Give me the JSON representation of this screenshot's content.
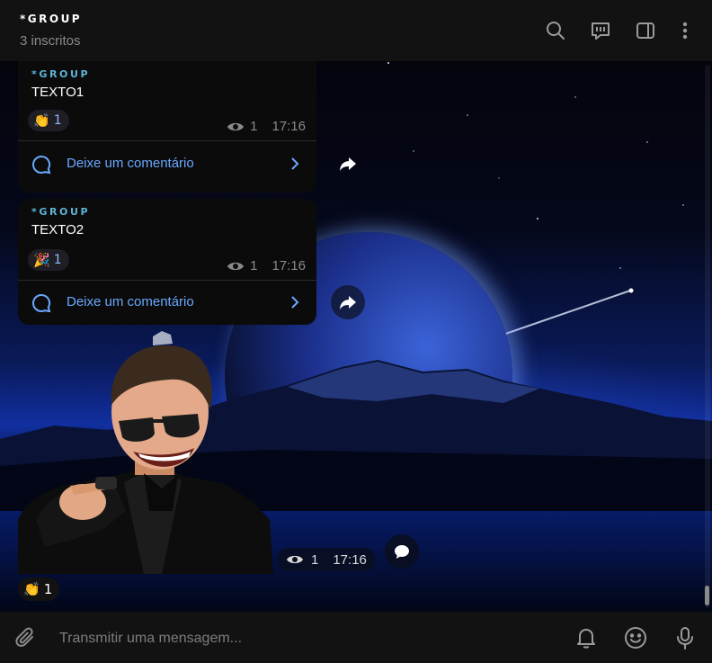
{
  "header": {
    "title": "*GROUP",
    "subtitle": "3 inscritos",
    "icons": [
      "search-icon",
      "live-chat-icon",
      "sidebar-toggle-icon",
      "more-vertical-icon"
    ]
  },
  "messages": [
    {
      "sender": "*GROUP",
      "text": "TEXTO1",
      "reaction": {
        "emoji": "👏",
        "count": "1"
      },
      "views": "1",
      "time": "17:16",
      "comment_label": "Deixe um comentário"
    },
    {
      "sender": "*GROUP",
      "text": "TEXTO2",
      "reaction": {
        "emoji": "🎉",
        "count": "1"
      },
      "views": "1",
      "time": "17:16",
      "comment_label": "Deixe um comentário"
    }
  ],
  "sticker": {
    "views": "1",
    "time": "17:16",
    "reaction": {
      "emoji": "👏",
      "count": "1"
    }
  },
  "composer": {
    "placeholder": "Transmitir uma mensagem..."
  },
  "colors": {
    "accent": "#6aa8ff",
    "sender": "#5fb4d8",
    "bubble": "#0b0b0b",
    "header": "#121212"
  }
}
